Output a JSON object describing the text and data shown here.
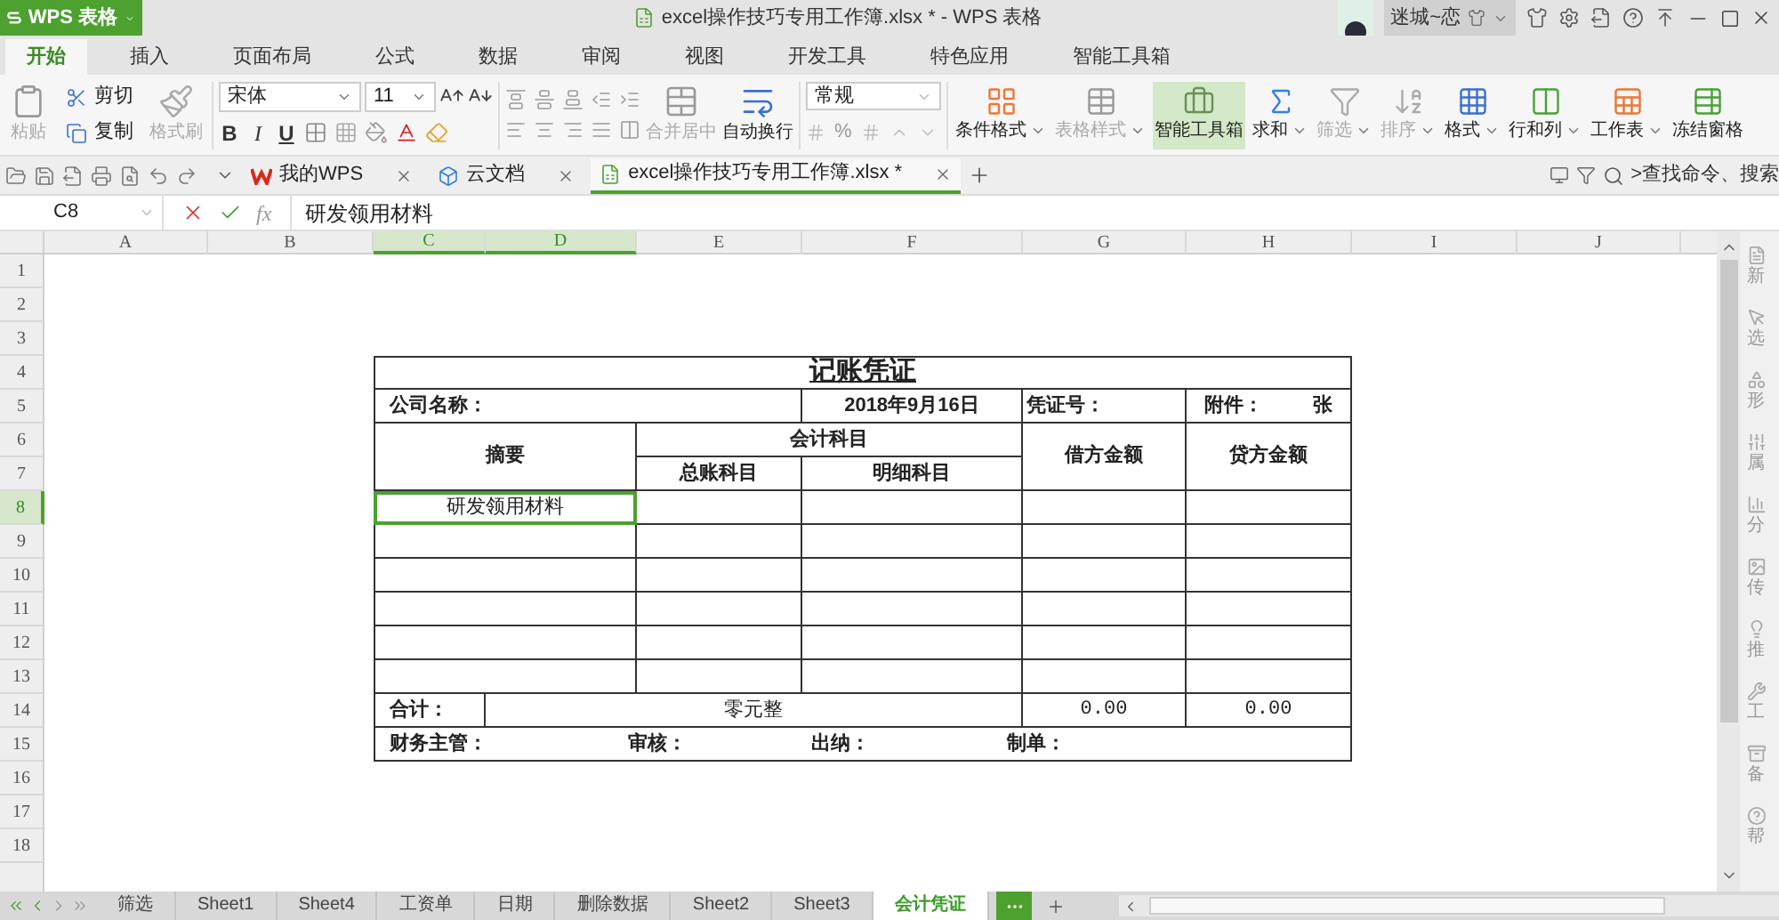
{
  "app_button": {
    "label": "WPS 表格"
  },
  "window": {
    "title": "excel操作技巧专用工作簿.xlsx * - WPS 表格",
    "user": "迷城~恋"
  },
  "ribbon_tabs": [
    {
      "label": "开始",
      "selected": true
    },
    {
      "label": "插入",
      "selected": false
    },
    {
      "label": "页面布局",
      "selected": false
    },
    {
      "label": "公式",
      "selected": false
    },
    {
      "label": "数据",
      "selected": false
    },
    {
      "label": "审阅",
      "selected": false
    },
    {
      "label": "视图",
      "selected": false
    },
    {
      "label": "开发工具",
      "selected": false
    },
    {
      "label": "特色应用",
      "selected": false
    },
    {
      "label": "智能工具箱",
      "selected": false
    }
  ],
  "ribbon": {
    "paste": {
      "label": "粘贴",
      "disabled": true
    },
    "cut": {
      "label": "剪切",
      "disabled": false
    },
    "copy": {
      "label": "复制",
      "disabled": false
    },
    "format_painter": {
      "label": "格式刷",
      "disabled": true
    },
    "font_name": "宋体",
    "font_size": "11",
    "font_styles": [
      "B",
      "I",
      "U"
    ],
    "merge": {
      "label": "合并居中",
      "disabled": true
    },
    "wrap": {
      "label": "自动换行",
      "disabled": false
    },
    "number_format": "常规",
    "percent": "%",
    "tools": [
      {
        "label": "条件格式",
        "disabled": false,
        "highlighted": false,
        "dropdown": true
      },
      {
        "label": "表格样式",
        "disabled": true,
        "highlighted": false,
        "dropdown": true
      },
      {
        "label": "智能工具箱",
        "disabled": false,
        "highlighted": true,
        "dropdown": false
      },
      {
        "label": "求和",
        "disabled": false,
        "highlighted": false,
        "dropdown": true
      },
      {
        "label": "筛选",
        "disabled": true,
        "highlighted": false,
        "dropdown": true
      },
      {
        "label": "排序",
        "disabled": true,
        "highlighted": false,
        "dropdown": true
      },
      {
        "label": "格式",
        "disabled": false,
        "highlighted": false,
        "dropdown": true
      },
      {
        "label": "行和列",
        "disabled": false,
        "highlighted": false,
        "dropdown": true
      },
      {
        "label": "工作表",
        "disabled": false,
        "highlighted": false,
        "dropdown": true
      },
      {
        "label": "冻结窗格",
        "disabled": false,
        "highlighted": false,
        "dropdown": false
      }
    ]
  },
  "doc_tabs": [
    {
      "label": "我的WPS",
      "selected": false
    },
    {
      "label": "云文档",
      "selected": false
    },
    {
      "label": "excel操作技巧专用工作簿.xlsx *",
      "selected": true
    }
  ],
  "command_search": {
    "placeholder": ">查找命令、搜索"
  },
  "formula_bar": {
    "cell": "C8",
    "fx": "fx",
    "value": "研发领用材料"
  },
  "columns": [
    {
      "label": "A",
      "selected": false
    },
    {
      "label": "B",
      "selected": false
    },
    {
      "label": "C",
      "selected": true
    },
    {
      "label": "D",
      "selected": true
    },
    {
      "label": "E",
      "selected": false
    },
    {
      "label": "F",
      "selected": false
    },
    {
      "label": "G",
      "selected": false
    },
    {
      "label": "H",
      "selected": false
    },
    {
      "label": "I",
      "selected": false
    },
    {
      "label": "J",
      "selected": false
    }
  ],
  "rows": [
    {
      "label": "1",
      "selected": false
    },
    {
      "label": "2",
      "selected": false
    },
    {
      "label": "3",
      "selected": false
    },
    {
      "label": "4",
      "selected": false
    },
    {
      "label": "5",
      "selected": false
    },
    {
      "label": "6",
      "selected": false
    },
    {
      "label": "7",
      "selected": false
    },
    {
      "label": "8",
      "selected": true
    },
    {
      "label": "9",
      "selected": false
    },
    {
      "label": "10",
      "selected": false
    },
    {
      "label": "11",
      "selected": false
    },
    {
      "label": "12",
      "selected": false
    },
    {
      "label": "13",
      "selected": false
    },
    {
      "label": "14",
      "selected": false
    },
    {
      "label": "15",
      "selected": false
    },
    {
      "label": "16",
      "selected": false
    },
    {
      "label": "17",
      "selected": false
    },
    {
      "label": "18",
      "selected": false
    }
  ],
  "voucher": {
    "title": "记账凭证",
    "company_label": "公司名称：",
    "date": "2018年9月16日",
    "voucher_no_label": "凭证号：",
    "attachment_label": "附件：",
    "attachment_unit": "张",
    "summary_header": "摘要",
    "account_header": "会计科目",
    "general_header": "总账科目",
    "detail_header": "明细科目",
    "debit_header": "借方金额",
    "credit_header": "贷方金额",
    "entries": [
      {
        "summary": "研发领用材料",
        "selected": true
      },
      {
        "selected": false
      },
      {
        "selected": false
      },
      {
        "selected": false
      },
      {
        "selected": false
      },
      {
        "selected": false
      }
    ],
    "total_label": "合计：",
    "total_words": "零元整",
    "total_debit": "0.00",
    "total_credit": "0.00",
    "signatures": [
      "财务主管：",
      "审核：",
      "出纳：",
      "制单："
    ]
  },
  "sheet_tabs": [
    {
      "label": "筛选",
      "selected": false
    },
    {
      "label": "Sheet1",
      "selected": false
    },
    {
      "label": "Sheet4",
      "selected": false
    },
    {
      "label": "工资单",
      "selected": false
    },
    {
      "label": "日期",
      "selected": false
    },
    {
      "label": "删除数据",
      "selected": false
    },
    {
      "label": "Sheet2",
      "selected": false
    },
    {
      "label": "Sheet3",
      "selected": false
    },
    {
      "label": "会计凭证",
      "selected": true
    }
  ],
  "side_panel": [
    "新",
    "选",
    "形",
    "属",
    "分",
    "传",
    "推",
    "工",
    "备",
    "帮"
  ]
}
